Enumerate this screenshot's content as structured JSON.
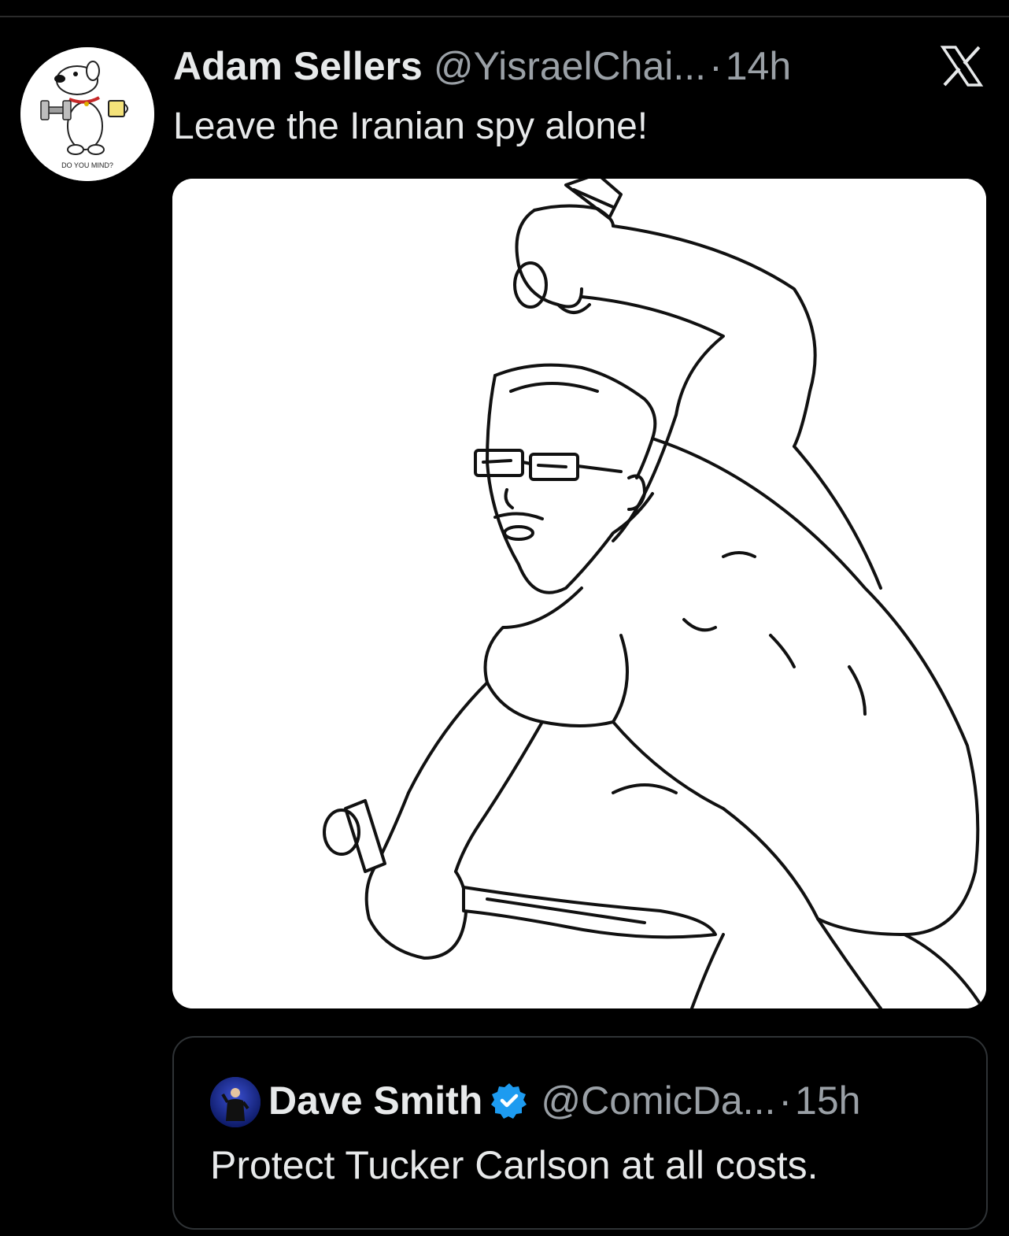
{
  "tweet": {
    "author_name": "Adam Sellers",
    "handle": "@YisraelChai...",
    "separator": "·",
    "time": "14h",
    "text": "Leave the Iranian spy alone!",
    "avatar_caption": "DO YOU MIND?"
  },
  "quoted_tweet": {
    "author_name": "Dave Smith",
    "handle": "@ComicDa...",
    "separator": "·",
    "time": "15h",
    "text": "Protect Tucker Carlson at all costs.",
    "verified": true
  },
  "icons": {
    "platform_logo": "x-logo-icon",
    "verified_badge": "verified-badge-icon"
  },
  "colors": {
    "background": "#000000",
    "primary_text": "#e7e9ea",
    "secondary_text": "#9aa0a6",
    "border": "#2f3336",
    "verified_blue": "#1d9bf0"
  }
}
